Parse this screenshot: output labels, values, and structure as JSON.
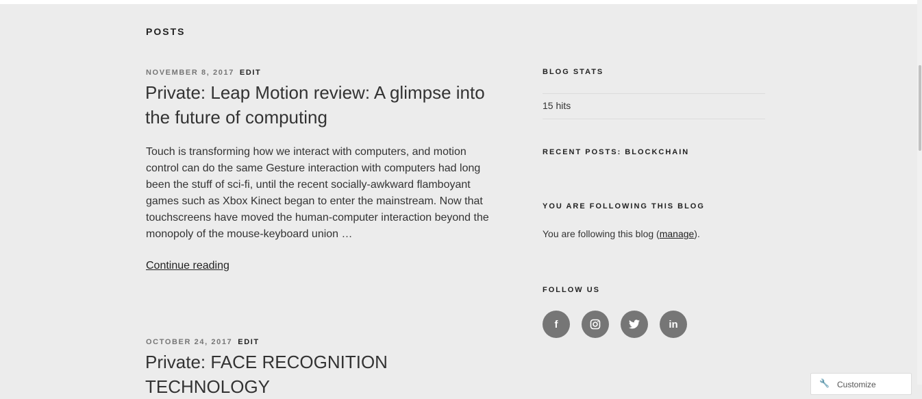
{
  "section": {
    "title": "POSTS"
  },
  "posts": [
    {
      "date": "NOVEMBER 8, 2017",
      "edit_label": "EDIT",
      "title": "Private: Leap Motion review: A glimpse into the future of computing",
      "excerpt": "Touch is transforming how we interact with computers, and motion control can do the same Gesture interaction with computers had long been the stuff of sci-fi, until the recent socially-awkward flamboyant games such as Xbox Kinect began to enter the mainstream. Now that touchscreens have moved the human-computer interaction beyond the monopoly of the mouse-keyboard union …",
      "continue_label": "Continue reading"
    },
    {
      "date": "OCTOBER 24, 2017",
      "edit_label": "EDIT",
      "title": "Private: FACE RECOGNITION TECHNOLOGY"
    }
  ],
  "sidebar": {
    "blog_stats": {
      "title": "BLOG STATS",
      "hits": "15 hits"
    },
    "recent_posts": {
      "title": "RECENT POSTS: BLOCKCHAIN"
    },
    "following": {
      "title": "YOU ARE FOLLOWING THIS BLOG",
      "text_before": "You are following this blog (",
      "link": "manage",
      "text_after": ")."
    },
    "follow_us": {
      "title": "FOLLOW US",
      "icons": [
        {
          "name": "facebook-icon",
          "glyph": "f"
        },
        {
          "name": "instagram-icon",
          "glyph": "◎"
        },
        {
          "name": "twitter-icon",
          "glyph": "🐦"
        },
        {
          "name": "linkedin-icon",
          "glyph": "in"
        }
      ]
    }
  },
  "customize": {
    "label": "Customize",
    "icon": "wrench-icon"
  },
  "colors": {
    "background": "#ececec",
    "meta": "#767676",
    "social": "#767676"
  }
}
